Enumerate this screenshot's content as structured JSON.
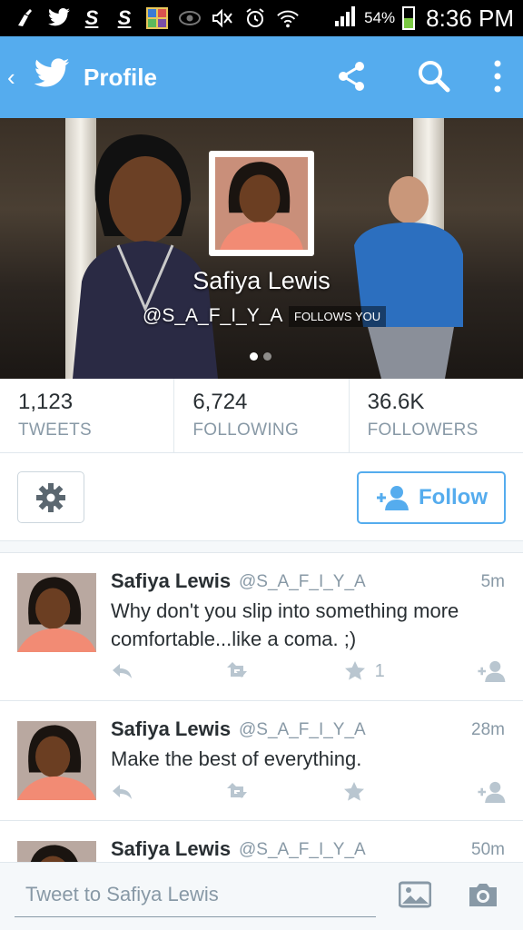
{
  "status_bar": {
    "icons": [
      "cleaning-icon",
      "twitter-icon",
      "s-app-icon",
      "s-app-icon",
      "gallery-icon",
      "eye-icon",
      "mute-icon",
      "alarm-icon",
      "wifi-icon",
      "signal-icon"
    ],
    "battery": "54%",
    "time": "8:36 PM"
  },
  "app_bar": {
    "title": "Profile",
    "accent": "#55acee"
  },
  "profile": {
    "name": "Safiya Lewis",
    "handle": "@S_A_F_I_Y_A",
    "follows_badge": "FOLLOWS YOU"
  },
  "stats": [
    {
      "value": "1,123",
      "label": "TWEETS"
    },
    {
      "value": "6,724",
      "label": "FOLLOWING"
    },
    {
      "value": "36.6K",
      "label": "FOLLOWERS"
    }
  ],
  "actions": {
    "follow_label": "Follow"
  },
  "tweets": [
    {
      "name": "Safiya Lewis",
      "handle": "@S_A_F_I_Y_A",
      "time": "5m",
      "text": "Why don't you slip into something more comfortable...like a coma. ;)",
      "favorites": "1"
    },
    {
      "name": "Safiya Lewis",
      "handle": "@S_A_F_I_Y_A",
      "time": "28m",
      "text": "Make the best of everything.",
      "favorites": ""
    },
    {
      "name": "Safiya Lewis",
      "handle": "@S_A_F_I_Y_A",
      "time": "50m",
      "text": "",
      "favorites": ""
    }
  ],
  "compose": {
    "placeholder": "Tweet to Safiya Lewis"
  }
}
